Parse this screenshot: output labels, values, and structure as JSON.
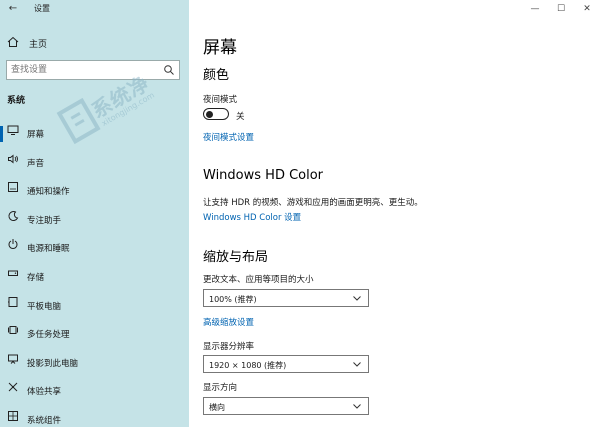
{
  "app": {
    "title": "设置"
  },
  "sidebar": {
    "home_label": "主页",
    "search_placeholder": "查找设置",
    "section_title": "系统",
    "items": [
      {
        "label": "屏幕",
        "icon": "monitor-icon"
      },
      {
        "label": "声音",
        "icon": "speaker-icon"
      },
      {
        "label": "通知和操作",
        "icon": "notification-icon"
      },
      {
        "label": "专注助手",
        "icon": "moon-icon"
      },
      {
        "label": "电源和睡眠",
        "icon": "power-icon"
      },
      {
        "label": "存储",
        "icon": "storage-icon"
      },
      {
        "label": "平板电脑",
        "icon": "tablet-icon"
      },
      {
        "label": "多任务处理",
        "icon": "multitask-icon"
      },
      {
        "label": "投影到此电脑",
        "icon": "project-icon"
      },
      {
        "label": "体验共享",
        "icon": "share-icon"
      },
      {
        "label": "系统组件",
        "icon": "components-icon"
      }
    ]
  },
  "watermark": {
    "text": "系统净",
    "sub": "xitongjing.com"
  },
  "main": {
    "title": "屏幕",
    "color_section": "颜色",
    "night_mode_label": "夜间模式",
    "night_mode_state": "关",
    "night_mode_link": "夜间模式设置",
    "hdr_section": "Windows HD Color",
    "hdr_desc": "让支持 HDR 的视频、游戏和应用的画面更明亮、更生动。",
    "hdr_link": "Windows HD Color 设置",
    "scale_section": "缩放与布局",
    "scale_label": "更改文本、应用等项目的大小",
    "scale_value": "100% (推荐)",
    "advanced_scale_link": "高级缩放设置",
    "resolution_label": "显示器分辨率",
    "resolution_value": "1920 × 1080 (推荐)",
    "orientation_label": "显示方向",
    "orientation_value": "横向"
  },
  "colors": {
    "sidebar_bg": "#c5e3e7",
    "accent": "#0063b1"
  }
}
